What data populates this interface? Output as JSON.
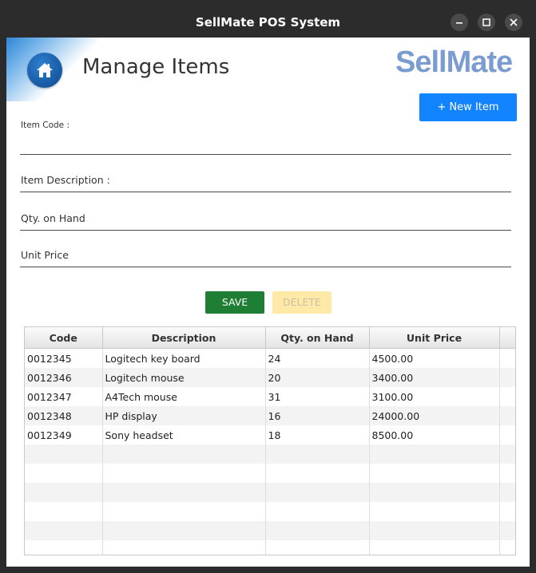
{
  "window": {
    "title": "SellMate POS System"
  },
  "header": {
    "title": "Manage Items",
    "logo_text": "SellMate",
    "new_item_label": "+ New Item"
  },
  "form": {
    "item_code_label": "Item Code :",
    "item_description_label": "Item Description :",
    "qty_on_hand_label": "Qty. on Hand",
    "unit_price_label": "Unit Price",
    "item_code_value": "",
    "item_description_value": "",
    "qty_on_hand_value": "",
    "unit_price_value": ""
  },
  "actions": {
    "save_label": "SAVE",
    "delete_label": "DELETE"
  },
  "table": {
    "columns": [
      "Code",
      "Description",
      "Qty. on Hand",
      "Unit Price"
    ],
    "rows": [
      [
        "0012345",
        "Logitech key board",
        "24",
        "4500.00"
      ],
      [
        "0012346",
        "Logitech mouse",
        "20",
        "3400.00"
      ],
      [
        "0012347",
        "A4Tech mouse",
        "31",
        "3100.00"
      ],
      [
        "0012348",
        "HP display",
        "16",
        "24000.00"
      ],
      [
        "0012349",
        "Sony headset",
        "18",
        "8500.00"
      ]
    ]
  },
  "colors": {
    "new_item_bg": "#1384ff",
    "save_bg": "#1e7e34",
    "delete_bg": "#ffe9a6",
    "logo": "#7a9cd0"
  },
  "icons": {
    "home": "home-icon",
    "minimize": "minimize-icon",
    "maximize": "maximize-icon",
    "close": "close-icon"
  }
}
